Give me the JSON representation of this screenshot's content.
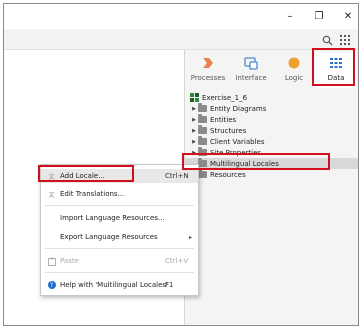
{
  "window": {
    "minimize_glyph": "–",
    "maximize_glyph": "❐",
    "close_glyph": "✕"
  },
  "toolbar": {
    "search_icon": "search-icon",
    "grid_icon": "grid-icon"
  },
  "tabs": [
    {
      "label": "Processes",
      "icon": "processes-icon",
      "color": "#e8834a"
    },
    {
      "label": "Interface",
      "icon": "interface-icon",
      "color": "#4a8ad0"
    },
    {
      "label": "Logic",
      "icon": "logic-icon",
      "color": "#f0a030"
    },
    {
      "label": "Data",
      "icon": "data-icon",
      "color": "#2d6fcf",
      "active": true
    }
  ],
  "tree": {
    "root": "Exercise_1_6",
    "items": [
      {
        "label": "Entity Diagrams",
        "expandable": true
      },
      {
        "label": "Entities",
        "expandable": true
      },
      {
        "label": "Structures",
        "expandable": true
      },
      {
        "label": "Client Variables",
        "expandable": true
      },
      {
        "label": "Site Properties",
        "expandable": true
      },
      {
        "label": "Multilingual Locales",
        "expandable": false,
        "selected": true
      },
      {
        "label": "Resources",
        "expandable": false
      }
    ]
  },
  "context_menu": {
    "items": [
      {
        "label": "Add Locale...",
        "shortcut": "Ctrl+N",
        "icon": "locale-icon"
      },
      {
        "label": "Edit Translations...",
        "shortcut": "",
        "icon": "translate-icon"
      },
      {
        "label": "Import Language Resources...",
        "shortcut": ""
      },
      {
        "label": "Export Language Resources",
        "shortcut": "",
        "submenu": "▸"
      },
      {
        "label": "Paste",
        "shortcut": "Ctrl+V",
        "icon": "paste-icon",
        "disabled": true
      },
      {
        "label": "Help with 'Multilingual Locales'",
        "shortcut": "F1",
        "icon": "help-icon"
      }
    ]
  },
  "highlight_color": "#d0101d"
}
